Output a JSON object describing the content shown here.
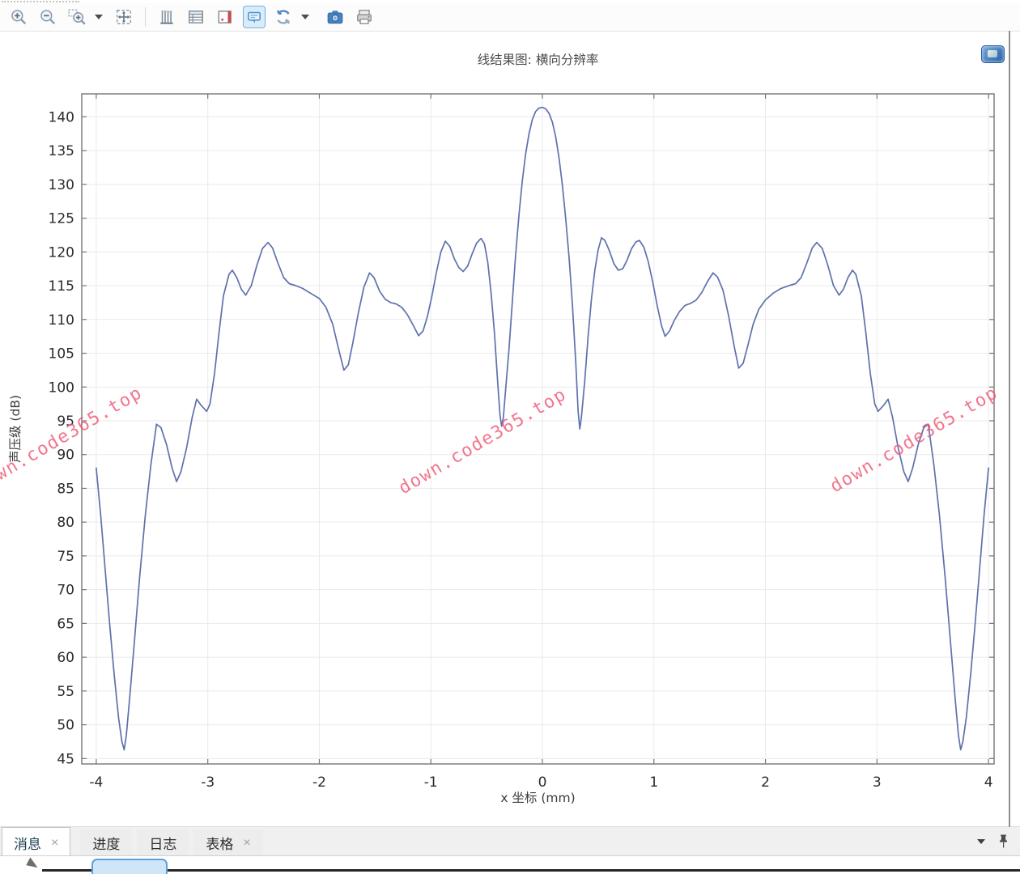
{
  "toolbar": {
    "icons": [
      {
        "name": "zoom-in",
        "selected": false
      },
      {
        "name": "zoom-out",
        "selected": false
      },
      {
        "name": "zoom-box",
        "selected": false
      },
      {
        "name": "zoom-dropdown-caret",
        "selected": false
      },
      {
        "name": "zoom-extents",
        "selected": false
      },
      {
        "name": "grid-lines-x",
        "selected": false
      },
      {
        "name": "grid-table",
        "selected": false
      },
      {
        "name": "axis-limits",
        "selected": false
      },
      {
        "name": "plot-tooltip",
        "selected": true
      },
      {
        "name": "refresh-plot",
        "selected": false
      },
      {
        "name": "refresh-dropdown-caret",
        "selected": false
      },
      {
        "name": "image-snapshot",
        "selected": false
      },
      {
        "name": "print",
        "selected": false
      }
    ]
  },
  "graphics": {
    "title": "线结果图: 横向分辨率",
    "watermark_text": "down.code365.top",
    "watermark_color": "#ef5571"
  },
  "chart_data": {
    "type": "line",
    "title": "线结果图: 横向分辨率",
    "xlabel": "x 坐标 (mm)",
    "ylabel": "声压级 (dB)",
    "xlim": [
      -4.13,
      4.05
    ],
    "ylim": [
      44.2,
      143.4
    ],
    "x_ticks": [
      -4,
      -3,
      -2,
      -1,
      0,
      1,
      2,
      3,
      4
    ],
    "y_ticks": [
      45,
      50,
      55,
      60,
      65,
      70,
      75,
      80,
      85,
      90,
      95,
      100,
      105,
      110,
      115,
      120,
      125,
      130,
      135,
      140
    ],
    "grid": true,
    "legend": false,
    "series": [
      {
        "name": "声压级 (dB)",
        "color": "#5e71ad",
        "points": [
          [
            -4.0,
            88
          ],
          [
            -3.96,
            81
          ],
          [
            -3.92,
            73
          ],
          [
            -3.88,
            65
          ],
          [
            -3.84,
            57.5
          ],
          [
            -3.8,
            51
          ],
          [
            -3.77,
            47.5
          ],
          [
            -3.75,
            46.3
          ],
          [
            -3.73,
            48.5
          ],
          [
            -3.7,
            54
          ],
          [
            -3.66,
            62
          ],
          [
            -3.61,
            72
          ],
          [
            -3.56,
            81
          ],
          [
            -3.51,
            88.5
          ],
          [
            -3.46,
            94.5
          ],
          [
            -3.42,
            94
          ],
          [
            -3.37,
            91.5
          ],
          [
            -3.32,
            88
          ],
          [
            -3.28,
            86
          ],
          [
            -3.24,
            87.5
          ],
          [
            -3.19,
            91
          ],
          [
            -3.14,
            95.5
          ],
          [
            -3.1,
            98.2
          ],
          [
            -3.06,
            97.3
          ],
          [
            -3.01,
            96.4
          ],
          [
            -2.98,
            97.5
          ],
          [
            -2.94,
            102
          ],
          [
            -2.9,
            108
          ],
          [
            -2.86,
            113.5
          ],
          [
            -2.81,
            116.7
          ],
          [
            -2.78,
            117.3
          ],
          [
            -2.74,
            116.2
          ],
          [
            -2.7,
            114.5
          ],
          [
            -2.66,
            113.6
          ],
          [
            -2.61,
            115
          ],
          [
            -2.56,
            118
          ],
          [
            -2.51,
            120.5
          ],
          [
            -2.46,
            121.4
          ],
          [
            -2.42,
            120.6
          ],
          [
            -2.37,
            118.3
          ],
          [
            -2.32,
            116.2
          ],
          [
            -2.27,
            115.3
          ],
          [
            -2.21,
            115.0
          ],
          [
            -2.15,
            114.6
          ],
          [
            -2.08,
            113.9
          ],
          [
            -2.0,
            113.1
          ],
          [
            -1.94,
            111.8
          ],
          [
            -1.88,
            109.3
          ],
          [
            -1.83,
            105.8
          ],
          [
            -1.78,
            102.5
          ],
          [
            -1.74,
            103.3
          ],
          [
            -1.7,
            106.5
          ],
          [
            -1.65,
            111
          ],
          [
            -1.6,
            114.8
          ],
          [
            -1.55,
            116.9
          ],
          [
            -1.51,
            116.2
          ],
          [
            -1.46,
            114.2
          ],
          [
            -1.41,
            113
          ],
          [
            -1.36,
            112.5
          ],
          [
            -1.31,
            112.3
          ],
          [
            -1.26,
            111.8
          ],
          [
            -1.21,
            110.7
          ],
          [
            -1.16,
            109.2
          ],
          [
            -1.11,
            107.6
          ],
          [
            -1.07,
            108.3
          ],
          [
            -1.03,
            110.5
          ],
          [
            -0.99,
            113.5
          ],
          [
            -0.95,
            117
          ],
          [
            -0.91,
            120
          ],
          [
            -0.87,
            121.6
          ],
          [
            -0.83,
            120.8
          ],
          [
            -0.79,
            119
          ],
          [
            -0.75,
            117.7
          ],
          [
            -0.71,
            117.1
          ],
          [
            -0.67,
            117.9
          ],
          [
            -0.63,
            119.7
          ],
          [
            -0.59,
            121.3
          ],
          [
            -0.55,
            122.0
          ],
          [
            -0.52,
            121.2
          ],
          [
            -0.49,
            118.5
          ],
          [
            -0.46,
            114
          ],
          [
            -0.43,
            108
          ],
          [
            -0.4,
            100.5
          ],
          [
            -0.38,
            95.8
          ],
          [
            -0.365,
            94.2
          ],
          [
            -0.35,
            95.5
          ],
          [
            -0.33,
            99.5
          ],
          [
            -0.3,
            105.5
          ],
          [
            -0.27,
            112.5
          ],
          [
            -0.24,
            119.5
          ],
          [
            -0.21,
            125.5
          ],
          [
            -0.18,
            130.5
          ],
          [
            -0.15,
            134.5
          ],
          [
            -0.12,
            137.5
          ],
          [
            -0.09,
            139.6
          ],
          [
            -0.06,
            140.8
          ],
          [
            -0.03,
            141.3
          ],
          [
            0.0,
            141.4
          ],
          [
            0.03,
            141.2
          ],
          [
            0.06,
            140.5
          ],
          [
            0.09,
            139.2
          ],
          [
            0.12,
            137.0
          ],
          [
            0.15,
            133.8
          ],
          [
            0.18,
            129.8
          ],
          [
            0.21,
            124.8
          ],
          [
            0.24,
            119.0
          ],
          [
            0.27,
            112.0
          ],
          [
            0.3,
            103.5
          ],
          [
            0.32,
            96.5
          ],
          [
            0.335,
            93.8
          ],
          [
            0.35,
            95.5
          ],
          [
            0.38,
            101
          ],
          [
            0.41,
            107.5
          ],
          [
            0.44,
            113
          ],
          [
            0.47,
            117.3
          ],
          [
            0.5,
            120.3
          ],
          [
            0.53,
            122.1
          ],
          [
            0.56,
            121.7
          ],
          [
            0.6,
            120.2
          ],
          [
            0.64,
            118.3
          ],
          [
            0.68,
            117.3
          ],
          [
            0.72,
            117.5
          ],
          [
            0.76,
            118.8
          ],
          [
            0.8,
            120.5
          ],
          [
            0.84,
            121.5
          ],
          [
            0.87,
            121.7
          ],
          [
            0.91,
            120.7
          ],
          [
            0.95,
            118.5
          ],
          [
            0.99,
            115.5
          ],
          [
            1.03,
            112
          ],
          [
            1.07,
            109
          ],
          [
            1.1,
            107.5
          ],
          [
            1.14,
            108.3
          ],
          [
            1.18,
            109.8
          ],
          [
            1.23,
            111.2
          ],
          [
            1.28,
            112.1
          ],
          [
            1.33,
            112.4
          ],
          [
            1.38,
            112.9
          ],
          [
            1.43,
            114
          ],
          [
            1.48,
            115.6
          ],
          [
            1.53,
            116.9
          ],
          [
            1.57,
            116.3
          ],
          [
            1.62,
            114.3
          ],
          [
            1.67,
            110.5
          ],
          [
            1.72,
            106
          ],
          [
            1.76,
            102.8
          ],
          [
            1.8,
            103.5
          ],
          [
            1.84,
            106
          ],
          [
            1.89,
            109.3
          ],
          [
            1.94,
            111.5
          ],
          [
            2.0,
            112.9
          ],
          [
            2.07,
            113.9
          ],
          [
            2.14,
            114.6
          ],
          [
            2.21,
            115.0
          ],
          [
            2.27,
            115.3
          ],
          [
            2.32,
            116.2
          ],
          [
            2.37,
            118.3
          ],
          [
            2.42,
            120.6
          ],
          [
            2.46,
            121.4
          ],
          [
            2.51,
            120.5
          ],
          [
            2.56,
            118
          ],
          [
            2.61,
            115
          ],
          [
            2.66,
            113.6
          ],
          [
            2.7,
            114.5
          ],
          [
            2.74,
            116.2
          ],
          [
            2.78,
            117.3
          ],
          [
            2.81,
            116.7
          ],
          [
            2.86,
            113.5
          ],
          [
            2.9,
            108
          ],
          [
            2.94,
            102
          ],
          [
            2.98,
            97.5
          ],
          [
            3.01,
            96.4
          ],
          [
            3.06,
            97.3
          ],
          [
            3.1,
            98.2
          ],
          [
            3.14,
            95.5
          ],
          [
            3.19,
            91
          ],
          [
            3.24,
            87.5
          ],
          [
            3.28,
            86
          ],
          [
            3.32,
            88
          ],
          [
            3.37,
            91.5
          ],
          [
            3.42,
            94
          ],
          [
            3.46,
            94.5
          ],
          [
            3.51,
            88.5
          ],
          [
            3.56,
            81
          ],
          [
            3.61,
            72
          ],
          [
            3.66,
            62
          ],
          [
            3.7,
            54
          ],
          [
            3.73,
            48.5
          ],
          [
            3.75,
            46.3
          ],
          [
            3.77,
            47.5
          ],
          [
            3.8,
            51
          ],
          [
            3.84,
            57.5
          ],
          [
            3.88,
            65
          ],
          [
            3.92,
            73
          ],
          [
            3.96,
            81
          ],
          [
            4.0,
            88
          ]
        ]
      }
    ]
  },
  "bottom_tabs": {
    "items": [
      {
        "label": "消息",
        "active": true,
        "closable": true
      },
      {
        "label": "进度",
        "active": false,
        "closable": false
      },
      {
        "label": "日志",
        "active": false,
        "closable": false
      },
      {
        "label": "表格",
        "active": false,
        "closable": true
      }
    ],
    "close_glyph": "×"
  }
}
